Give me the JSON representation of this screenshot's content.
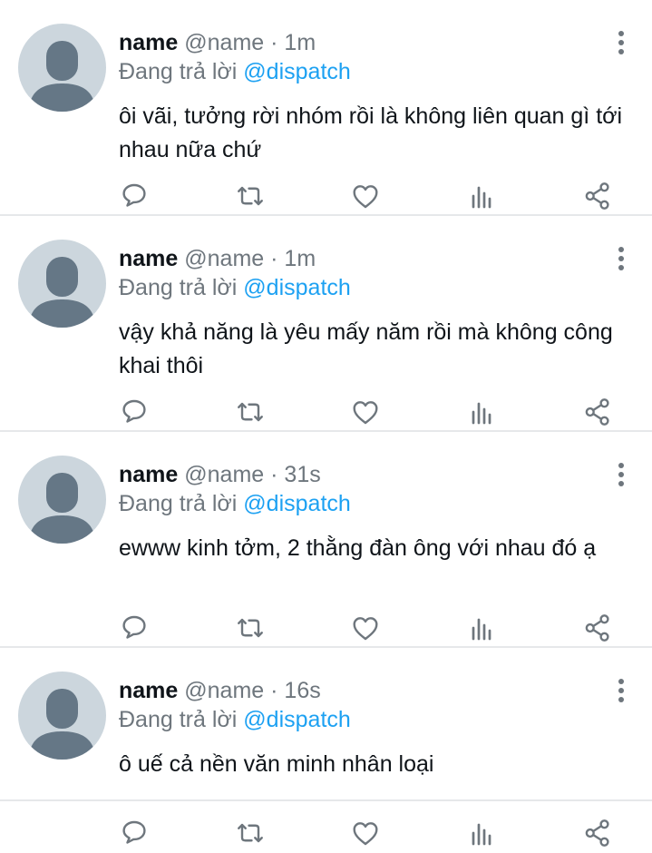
{
  "tweets": [
    {
      "display_name": "name",
      "handle": "@name",
      "sep": "·",
      "time": "1m",
      "reply_prefix": "Đang trả lời",
      "reply_to": "@dispatch",
      "text": "ôi vãi, tưởng rời nhóm rồi là không liên quan gì tới nhau nữa chứ"
    },
    {
      "display_name": "name",
      "handle": "@name",
      "sep": "·",
      "time": "1m",
      "reply_prefix": "Đang trả lời",
      "reply_to": "@dispatch",
      "text": "vậy khả năng là yêu mấy năm rồi mà không công khai thôi"
    },
    {
      "display_name": "name",
      "handle": "@name",
      "sep": "·",
      "time": "31s",
      "reply_prefix": "Đang trả lời",
      "reply_to": "@dispatch",
      "text": "ewww kinh tởm, 2 thằng đàn ông với nhau đó ạ"
    },
    {
      "display_name": "name",
      "handle": "@name",
      "sep": "·",
      "time": "16s",
      "reply_prefix": "Đang trả lời",
      "reply_to": "@dispatch",
      "text": "ô uế cả nền văn minh nhân loại"
    }
  ],
  "icons": [
    "more-vertical-icon",
    "reply-icon",
    "retweet-icon",
    "like-icon",
    "analytics-icon",
    "share-icon"
  ],
  "colors": {
    "text": "#0f1419",
    "muted": "#6e767d",
    "mention": "#1da1f2",
    "avatar_bg": "#ccd6dd",
    "avatar_fg": "#657786",
    "divider": "#e6e8ea"
  }
}
